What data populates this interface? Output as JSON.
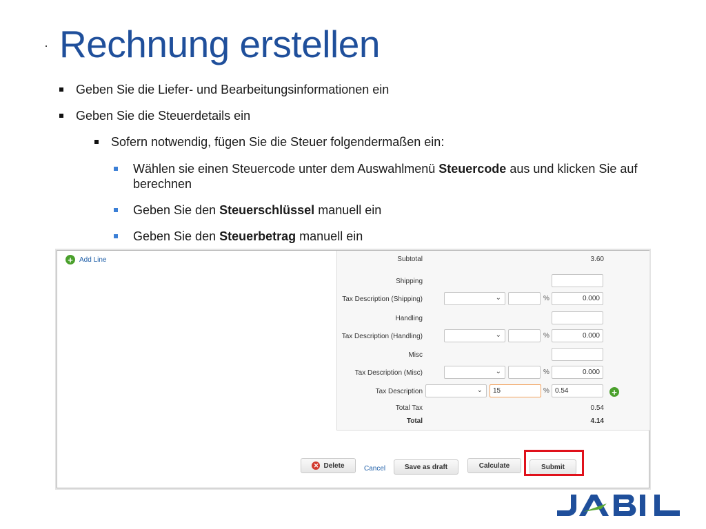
{
  "slide": {
    "title": "Rechnung erstellen",
    "bullets_l1": [
      "Geben Sie die Liefer- und Bearbeitungsinformationen ein",
      "Geben Sie die Steuerdetails ein"
    ],
    "bullet_l2": "Sofern notwendig, fügen Sie die Steuer folgendermaßen ein:",
    "bullets_l3": [
      {
        "pre": "Wählen sie einen Steuercode unter dem Auswahlmenü ",
        "bold": "Steuercode",
        "post": " aus und klicken Sie auf berechnen"
      },
      {
        "pre": "Geben Sie den ",
        "bold": "Steuerschlüssel",
        "post": " manuell ein"
      },
      {
        "pre": "Geben Sie den ",
        "bold": "Steuerbetrag",
        "post": " manuell ein"
      }
    ]
  },
  "form": {
    "add_line": "Add Line",
    "subtotal_label": "Subtotal",
    "subtotal_value": "3.60",
    "shipping_label": "Shipping",
    "tax_shipping_label": "Tax Description (Shipping)",
    "tax_shipping_amount": "0.000",
    "handling_label": "Handling",
    "tax_handling_label": "Tax Description (Handling)",
    "tax_handling_amount": "0.000",
    "misc_label": "Misc",
    "tax_misc_label": "Tax Description (Misc)",
    "tax_misc_amount": "0.000",
    "tax_desc_label": "Tax Description",
    "tax_rate_value": "15",
    "tax_amount_value": "0.54",
    "percent": "%",
    "total_tax_label": "Total Tax",
    "total_tax_value": "0.54",
    "total_label": "Total",
    "total_value": "4.14"
  },
  "buttons": {
    "delete": "Delete",
    "cancel": "Cancel",
    "save_draft": "Save as draft",
    "calculate": "Calculate",
    "submit": "Submit"
  },
  "colors": {
    "title": "#1f4f9b",
    "highlight": "#e0111b",
    "logo_blue": "#1f4f9b",
    "logo_green": "#5aa832"
  },
  "logo": "JABIL"
}
